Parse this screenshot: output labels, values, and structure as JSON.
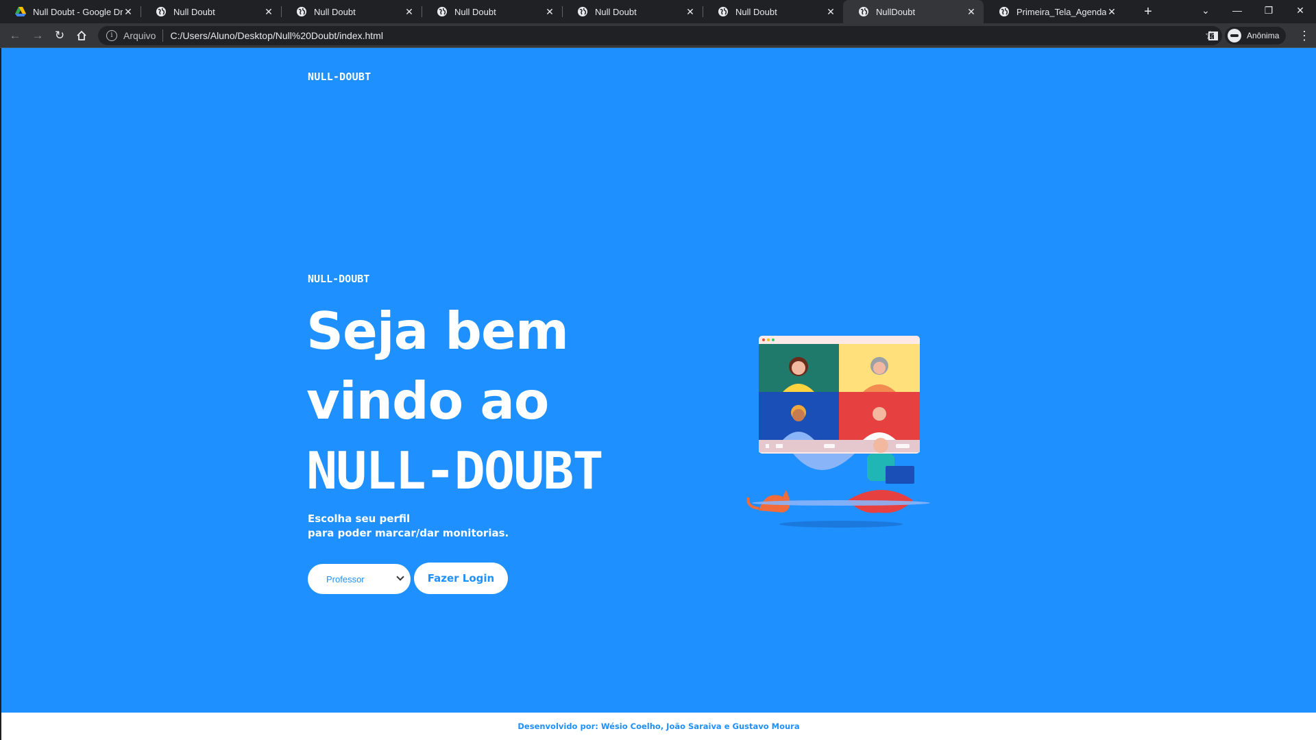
{
  "browser": {
    "tabs": [
      {
        "title": "Null Doubt - Google Drive",
        "icon": "google-drive-icon",
        "active": false
      },
      {
        "title": "Null Doubt",
        "icon": "globe-icon",
        "active": false
      },
      {
        "title": "Null Doubt",
        "icon": "globe-icon",
        "active": false
      },
      {
        "title": "Null Doubt",
        "icon": "globe-icon",
        "active": false
      },
      {
        "title": "Null Doubt",
        "icon": "globe-icon",
        "active": false
      },
      {
        "title": "Null Doubt",
        "icon": "globe-icon",
        "active": false
      },
      {
        "title": "NullDoubt",
        "icon": "globe-icon",
        "active": true
      },
      {
        "title": "Primeira_Tela_Agendamen",
        "icon": "globe-icon",
        "active": false
      }
    ],
    "address": {
      "chip": "Arquivo",
      "url": "C:/Users/Aluno/Desktop/Null%20Doubt/index.html"
    },
    "profile_label": "Anônima"
  },
  "page": {
    "brand_top": "NULL-DOUBT",
    "eyebrow": "NULL-DOUBT",
    "headline_line1": "Seja bem",
    "headline_line2": "vindo ao",
    "headline_line3": "NULL-DOUBT",
    "subtitle_line1": "Escolha seu perfil",
    "subtitle_line2": "para poder marcar/dar monitorias.",
    "profile_select": {
      "selected": "Professor"
    },
    "login_button": "Fazer Login",
    "footer": "Desenvolvido por: Wésio Coelho, João Saraiva e Gustavo Moura"
  },
  "colors": {
    "page_background": "#1e90ff",
    "accent_text": "#1e90ff",
    "chrome_dark": "#202124",
    "chrome_toolbar": "#35363a"
  }
}
